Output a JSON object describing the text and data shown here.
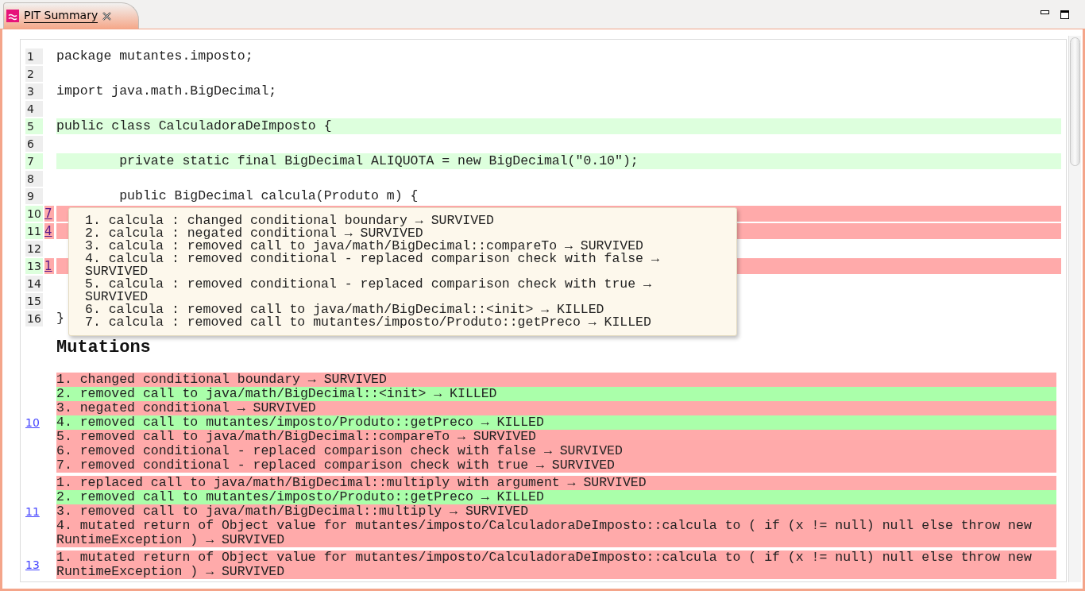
{
  "tab": {
    "title": "PIT Summary",
    "selected": true
  },
  "source": {
    "lines": [
      {
        "number": "1",
        "kind": "plain",
        "code": "package mutantes.imposto;"
      },
      {
        "number": "2",
        "kind": "plain"
      },
      {
        "number": "3",
        "kind": "plain",
        "code": "import java.math.BigDecimal;"
      },
      {
        "number": "4",
        "kind": "plain"
      },
      {
        "number": "5",
        "kind": "covered",
        "code": "public class CalculadoraDeImposto {"
      },
      {
        "number": "6",
        "kind": "plain"
      },
      {
        "number": "7",
        "kind": "covered",
        "code": "        private static final BigDecimal ALIQUOTA = new BigDecimal(\"0.10\");"
      },
      {
        "number": "8",
        "kind": "plain"
      },
      {
        "number": "9",
        "kind": "plain",
        "code": "        public BigDecimal calcula(Produto m) {"
      },
      {
        "number": "10",
        "kind": "mutated",
        "mutations": "7"
      },
      {
        "number": "11",
        "kind": "mutated",
        "mutations": "4"
      },
      {
        "number": "12",
        "kind": "plain"
      },
      {
        "number": "13",
        "kind": "mutated",
        "mutations": "1"
      },
      {
        "number": "14",
        "kind": "plain"
      },
      {
        "number": "15",
        "kind": "plain"
      },
      {
        "number": "16",
        "kind": "plain",
        "code": "}"
      }
    ]
  },
  "tooltip": {
    "lines": [
      "1. calcula : changed conditional boundary → SURVIVED",
      "2. calcula : negated conditional → SURVIVED",
      "3. calcula : removed call to java/math/BigDecimal::compareTo → SURVIVED",
      "4. calcula : removed conditional - replaced comparison check with false → SURVIVED",
      "5. calcula : removed conditional - replaced comparison check with true → SURVIVED",
      "6. calcula : removed call to java/math/BigDecimal::<init> → KILLED",
      "7. calcula : removed call to mutantes/imposto/Produto::getPreco → KILLED"
    ]
  },
  "mutations": {
    "title": "Mutations",
    "groups": [
      {
        "line": "10",
        "items": [
          {
            "text": "1. changed conditional boundary → SURVIVED",
            "detected": false
          },
          {
            "text": "2. removed call to java/math/BigDecimal::<init> → KILLED",
            "detected": true
          },
          {
            "text": "3. negated conditional → SURVIVED",
            "detected": false
          },
          {
            "text": "4. removed call to mutantes/imposto/Produto::getPreco → KILLED",
            "detected": true
          },
          {
            "text": "5. removed call to java/math/BigDecimal::compareTo → SURVIVED",
            "detected": false
          },
          {
            "text": "6. removed conditional - replaced comparison check with false → SURVIVED",
            "detected": false
          },
          {
            "text": "7. removed conditional - replaced comparison check with true → SURVIVED",
            "detected": false
          }
        ]
      },
      {
        "line": "11",
        "items": [
          {
            "text": "1. replaced call to java/math/BigDecimal::multiply with argument → SURVIVED",
            "detected": false
          },
          {
            "text": "2. removed call to mutantes/imposto/Produto::getPreco → KILLED",
            "detected": true
          },
          {
            "text": "3. removed call to java/math/BigDecimal::multiply → SURVIVED",
            "detected": false
          },
          {
            "text": "4. mutated return of Object value for mutantes/imposto/CalculadoraDeImposto::calcula to ( if (x != null) null else throw new RuntimeException ) → SURVIVED",
            "detected": false
          }
        ]
      },
      {
        "line": "13",
        "items": [
          {
            "text": "1. mutated return of Object value for mutantes/imposto/CalculadoraDeImposto::calcula to ( if (x != null) null else throw new RuntimeException ) → SURVIVED",
            "detected": false
          }
        ]
      }
    ]
  }
}
